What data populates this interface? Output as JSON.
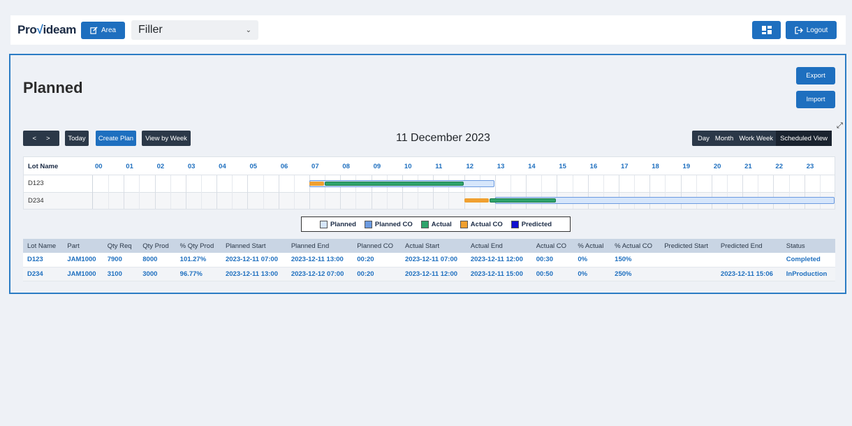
{
  "header": {
    "logo_text": "Provideam",
    "area_label": "Area",
    "selected_area": "Filler",
    "logout_label": "Logout"
  },
  "page": {
    "title": "Planned",
    "export_label": "Export",
    "import_label": "Import"
  },
  "toolbar": {
    "prev": "<",
    "next": ">",
    "today": "Today",
    "create_plan": "Create Plan",
    "view_by_week": "View by Week",
    "date_title": "11 December 2023",
    "views": [
      "Day",
      "Month",
      "Work Week",
      "Scheduled View"
    ],
    "active_view": "Scheduled View"
  },
  "gantt": {
    "lot_header": "Lot Name",
    "hours": [
      "00",
      "01",
      "02",
      "03",
      "04",
      "05",
      "06",
      "07",
      "08",
      "09",
      "10",
      "11",
      "12",
      "13",
      "14",
      "15",
      "16",
      "17",
      "18",
      "19",
      "20",
      "21",
      "22",
      "23"
    ],
    "rows": [
      {
        "name": "D123",
        "planned": [
          7,
          13
        ],
        "actual_co": [
          7,
          7.5
        ],
        "actual": [
          7.5,
          12
        ]
      },
      {
        "name": "D234",
        "planned": [
          13,
          24
        ],
        "actual_co": [
          12,
          12.83
        ],
        "planned_co": [
          13,
          13.33
        ],
        "actual": [
          12.83,
          15
        ]
      }
    ]
  },
  "legend": [
    {
      "label": "Planned",
      "color": "#d6e6fb"
    },
    {
      "label": "Planned CO",
      "color": "#6b9ae0"
    },
    {
      "label": "Actual",
      "color": "#2fa36b"
    },
    {
      "label": "Actual CO",
      "color": "#f0a030"
    },
    {
      "label": "Predicted",
      "color": "#1010d0"
    }
  ],
  "table": {
    "columns": [
      "Lot Name",
      "Part",
      "Qty Req",
      "Qty Prod",
      "% Qty Prod",
      "Planned Start",
      "Planned End",
      "Planned CO",
      "Actual Start",
      "Actual End",
      "Actual CO",
      "% Actual",
      "% Actual CO",
      "Predicted Start",
      "Predicted End",
      "Status"
    ],
    "rows": [
      [
        "D123",
        "JAM1000",
        "7900",
        "8000",
        "101.27%",
        "2023-12-11 07:00",
        "2023-12-11 13:00",
        "00:20",
        "2023-12-11 07:00",
        "2023-12-11 12:00",
        "00:30",
        "0%",
        "150%",
        "",
        "",
        "Completed"
      ],
      [
        "D234",
        "JAM1000",
        "3100",
        "3000",
        "96.77%",
        "2023-12-11 13:00",
        "2023-12-12 07:00",
        "00:20",
        "2023-12-11 12:00",
        "2023-12-11 15:00",
        "00:50",
        "0%",
        "250%",
        "",
        "2023-12-11 15:06",
        "InProduction"
      ]
    ]
  },
  "colors": {
    "primary": "#1e6fbf",
    "dark": "#2b3848",
    "planned": "#d6e6fb",
    "planned_border": "#6b9ae0",
    "actual": "#2fa36b",
    "actual_co": "#f0a030"
  }
}
